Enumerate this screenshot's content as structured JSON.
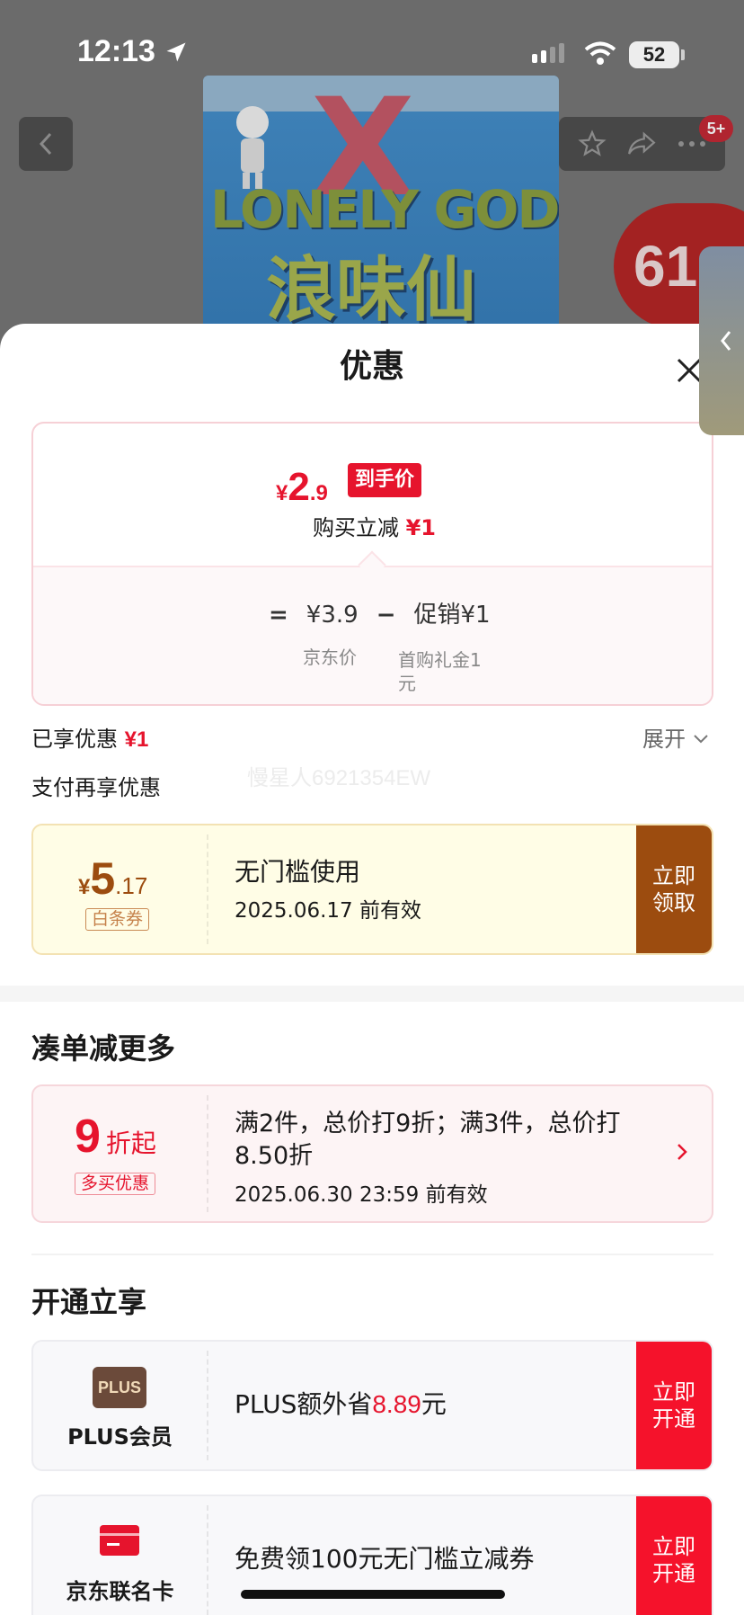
{
  "status_bar": {
    "time": "12:13",
    "battery": "52"
  },
  "background": {
    "product_logo_en": "LONELY GOD",
    "product_logo_cn": "浪味仙",
    "promo_badge": "61",
    "notification_count": "5+"
  },
  "sheet": {
    "title": "优惠",
    "price_card": {
      "final_price_currency": "¥",
      "final_price_int": "2",
      "final_price_dec": ".9",
      "final_price_tag": "到手价",
      "discount_label": "购买立减",
      "discount_value": "¥1",
      "formula_eq": "=",
      "jd_price": "¥3.9",
      "formula_minus": "−",
      "promo": "促销¥1",
      "jd_price_label": "京东价",
      "promo_note": "首购礼金1元"
    },
    "enjoyed_label": "已享优惠",
    "enjoyed_value": "¥1",
    "expand_label": "展开",
    "pay_more_label": "支付再享优惠",
    "watermark": "慢星人6921354EW",
    "baitiao_coupon": {
      "currency": "¥",
      "amount_int": "5",
      "amount_dec": ".17",
      "tag": "白条券",
      "title": "无门槛使用",
      "validity": "2025.06.17 前有效",
      "action": "立即领取"
    },
    "bundle_section": {
      "title": "凑单减更多",
      "discount_num": "9",
      "discount_unit": "折起",
      "tag": "多买优惠",
      "description": "满2件，总价打9折；满3件，总价打8.50折",
      "validity": "2025.06.30 23:59 前有效"
    },
    "membership_section": {
      "title": "开通立享",
      "plus": {
        "logo": "PLUS",
        "name": "PLUS会员",
        "text_prefix": "PLUS额外省",
        "amount": "8.89",
        "text_suffix": "元",
        "action": "立即开通"
      },
      "jd_card": {
        "name": "京东联名卡",
        "text": "免费领100元无门槛立减券",
        "action": "立即开通"
      }
    }
  },
  "colors": {
    "accent_red": "#e6142d",
    "baitiao_brown": "#9c4c0f",
    "action_red": "#f5122b"
  }
}
